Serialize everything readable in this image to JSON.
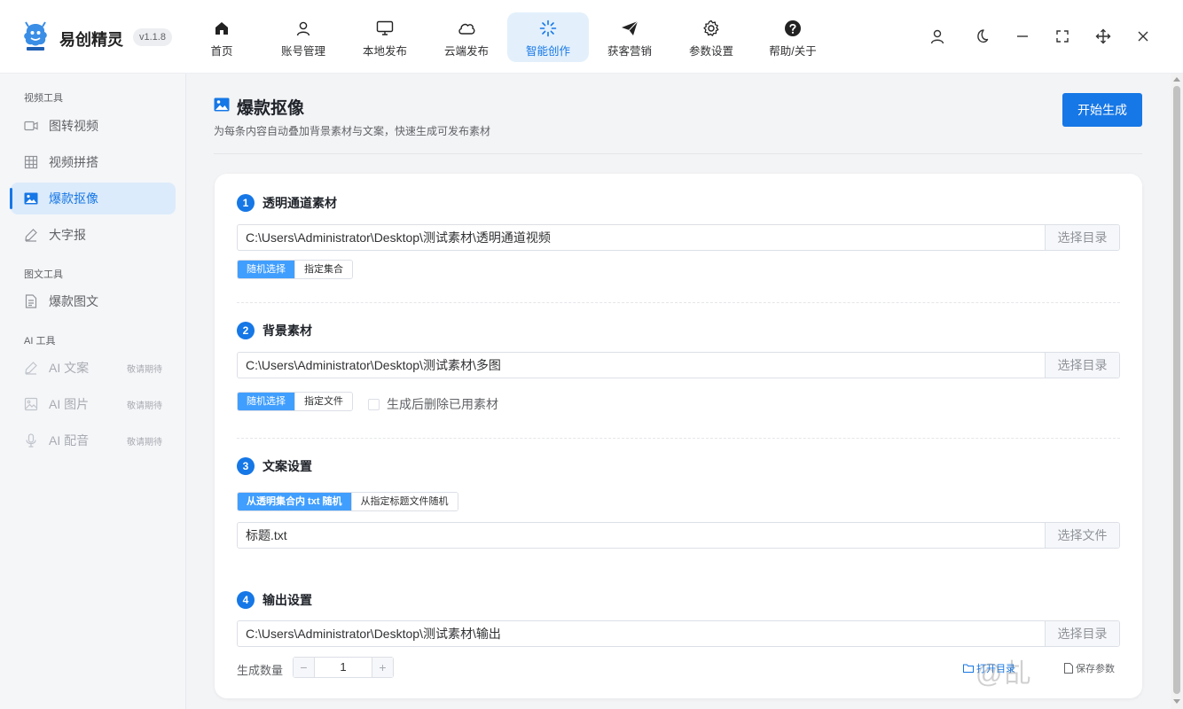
{
  "app": {
    "name": "易创精灵",
    "version": "v1.1.8",
    "logo_text": "易创精灵"
  },
  "nav": [
    {
      "label": "首页",
      "icon": "home-icon"
    },
    {
      "label": "账号管理",
      "icon": "user-icon"
    },
    {
      "label": "本地发布",
      "icon": "monitor-icon"
    },
    {
      "label": "云端发布",
      "icon": "cloud-icon"
    },
    {
      "label": "智能创作",
      "icon": "sparkle-icon",
      "active": true
    },
    {
      "label": "获客营销",
      "icon": "paper-plane-icon"
    },
    {
      "label": "参数设置",
      "icon": "gear-icon"
    },
    {
      "label": "帮助/关于",
      "icon": "help-icon"
    }
  ],
  "window_controls": [
    "user-icon",
    "moon-icon",
    "minimize-icon",
    "fullscreen-icon",
    "move-icon",
    "close-icon"
  ],
  "sidebar": {
    "groups": [
      {
        "title": "视频工具",
        "items": [
          {
            "label": "图转视频",
            "icon": "video-icon"
          },
          {
            "label": "视频拼搭",
            "icon": "grid-icon"
          },
          {
            "label": "爆款抠像",
            "icon": "image-icon",
            "active": true
          },
          {
            "label": "大字报",
            "icon": "pen-icon"
          }
        ]
      },
      {
        "title": "图文工具",
        "items": [
          {
            "label": "爆款图文",
            "icon": "document-icon"
          }
        ]
      },
      {
        "title": "AI 工具",
        "items": [
          {
            "label": "AI 文案",
            "icon": "pen-icon",
            "badge": "敬请期待",
            "disabled": true
          },
          {
            "label": "AI 图片",
            "icon": "picture-icon",
            "badge": "敬请期待",
            "disabled": true
          },
          {
            "label": "AI 配音",
            "icon": "microphone-icon",
            "badge": "敬请期待",
            "disabled": true
          }
        ]
      }
    ]
  },
  "page": {
    "title": "爆款抠像",
    "subtitle": "为每条内容自动叠加背景素材与文案，快速生成可发布素材",
    "start_button": "开始生成"
  },
  "sections": {
    "s1": {
      "num": "1",
      "title": "透明通道素材",
      "path": "C:\\Users\\Administrator\\Desktop\\测试素材\\透明通道视频",
      "button": "选择目录",
      "options": [
        "随机选择",
        "指定集合"
      ]
    },
    "s2": {
      "num": "2",
      "title": "背景素材",
      "path": "C:\\Users\\Administrator\\Desktop\\测试素材\\多图",
      "button": "选择目录",
      "options": [
        "随机选择",
        "指定文件"
      ],
      "checkbox": "生成后删除已用素材"
    },
    "s3": {
      "num": "3",
      "title": "文案设置",
      "options": [
        "从透明集合内 txt 随机",
        "从指定标题文件随机"
      ],
      "path": "标题.txt",
      "button": "选择文件"
    },
    "s4": {
      "num": "4",
      "title": "输出设置",
      "path": "C:\\Users\\Administrator\\Desktop\\测试素材\\输出",
      "button": "选择目录",
      "count_label": "生成数量",
      "count_value": "1",
      "open_dir": "打开目录",
      "save_params": "保存参数"
    }
  },
  "watermark": "@乩",
  "colors": {
    "accent": "#1677e6",
    "segment_active": "#409eff",
    "active_bg": "#e3f0fc"
  }
}
